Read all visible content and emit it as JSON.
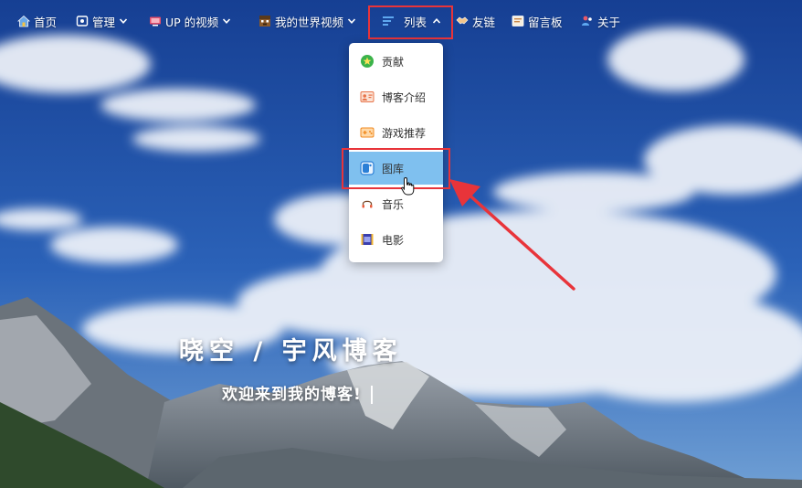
{
  "nav": {
    "home": "首页",
    "manage": "管理",
    "up_videos": "UP 的视频",
    "minecraft_videos": "我的世界视频",
    "list": "列表",
    "friends": "友链",
    "guestbook": "留言板",
    "about": "关于"
  },
  "dropdown": {
    "items": [
      {
        "label": "贡献",
        "icon": "star-badge-icon"
      },
      {
        "label": "博客介绍",
        "icon": "id-card-icon"
      },
      {
        "label": "游戏推荐",
        "icon": "gamepad-icon"
      },
      {
        "label": "图库",
        "icon": "gallery-icon"
      },
      {
        "label": "音乐",
        "icon": "headphones-icon"
      },
      {
        "label": "电影",
        "icon": "film-icon"
      }
    ]
  },
  "hero": {
    "title": "晓空  /  宇风博客",
    "subtitle": "欢迎来到我的博客!"
  },
  "colors": {
    "highlight": "#e8343a",
    "active_item": "#7fc0ef",
    "sky": "#1f4fa6"
  }
}
